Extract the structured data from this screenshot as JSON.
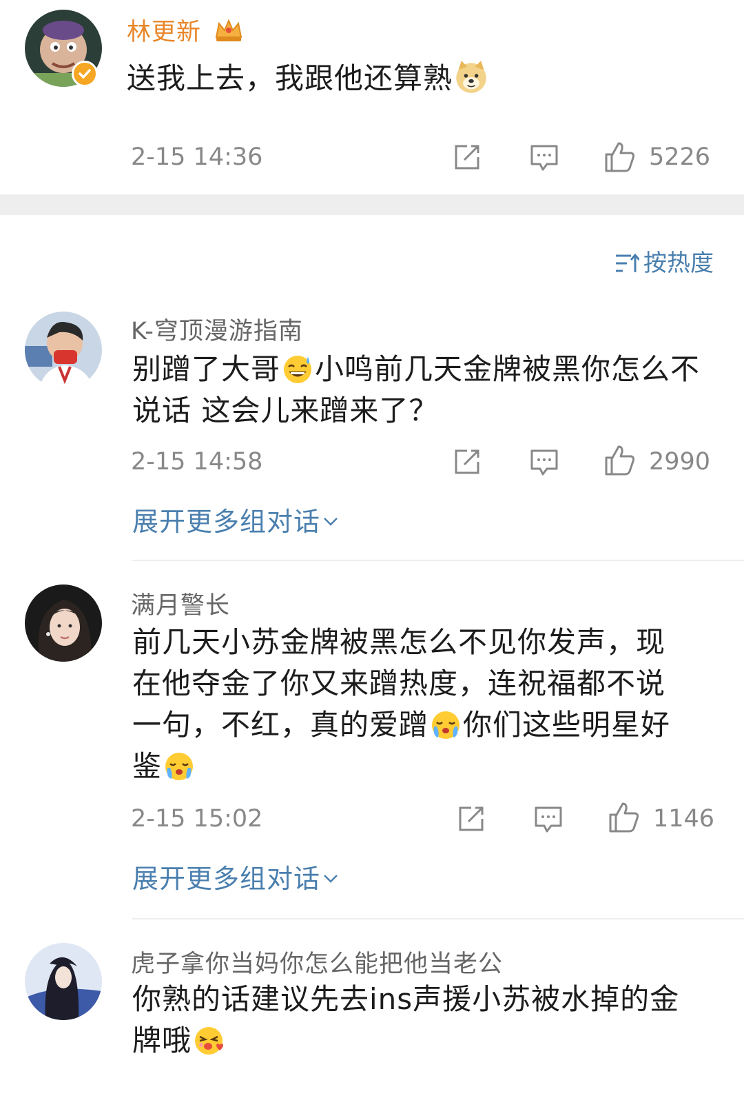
{
  "top_comment": {
    "username": "林更新",
    "badge_icon": "crown-icon",
    "verified_icon": "verified-badge-icon",
    "text": "送我上去，我跟他还算熟",
    "emoji": "doge-emoji-icon",
    "time": "2-15 14:36",
    "likes": "5226"
  },
  "sort": {
    "label": "按热度",
    "icon": "sort-icon"
  },
  "comments": [
    {
      "username": "K-穹顶漫游指南",
      "text_parts": [
        "别蹭了大哥",
        "小鸣前几天金牌被黑你怎么不说话 这会儿来蹭来了？"
      ],
      "emoji": "sweat-smile-emoji-icon",
      "time": "2-15 14:58",
      "likes": "2990",
      "expand_label": "展开更多组对话"
    },
    {
      "username": "满月警长",
      "text_parts": [
        "前几天小苏金牌被黑怎么不见你发声，现在他夺金了你又来蹭热度，连祝福都不说一句，不红，真的爱蹭",
        "你们这些明星好鉴"
      ],
      "emoji": "crying-emoji-icon",
      "time": "2-15 15:02",
      "likes": "1146",
      "expand_label": "展开更多组对话"
    },
    {
      "username": "虎子拿你当妈你怎么能把他当老公",
      "text_parts": [
        "你熟的话建议先去ins声援小苏被水掉的金牌哦"
      ],
      "emoji": "kiss-emoji-icon"
    }
  ],
  "colors": {
    "username_highlight": "#e8862a",
    "link_blue": "#4a7fae",
    "meta_gray": "#888888",
    "separator": "#eeeeee"
  }
}
